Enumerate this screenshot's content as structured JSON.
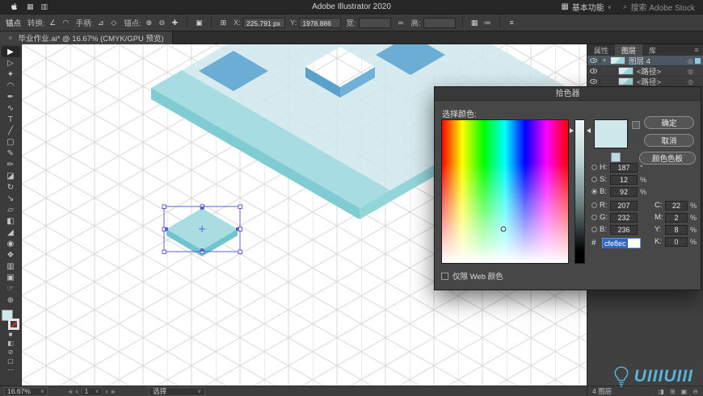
{
  "menubar": {
    "title": "Adobe Illustrator 2020",
    "left_icons": [
      {
        "name": "app-home-icon",
        "glyph": "▦"
      },
      {
        "name": "arrange-documents-icon",
        "glyph": "▥"
      }
    ],
    "workspace": {
      "icon": "▦",
      "label": "基本功能",
      "caret": "∨"
    },
    "search": {
      "icon": "⌕",
      "placeholder": "搜索 Adobe Stock"
    }
  },
  "controlbar": {
    "context_label": "锚点",
    "convert": {
      "label": "转换:",
      "icons": [
        "∠",
        "◠"
      ]
    },
    "handles": {
      "label": "手柄:",
      "icons": [
        "⊿",
        "◇"
      ]
    },
    "anchors": {
      "label": "锚点:",
      "icons": [
        "⊕",
        "⊖",
        "✚"
      ]
    },
    "isolate_icon": "▣",
    "ref_icon": "⊞",
    "x_label": "X:",
    "x_value": "225.791 px",
    "y_label": "Y:",
    "y_value": "1978.886",
    "w_label": "宽:",
    "w_value": "",
    "h_label": "高:",
    "h_value": "",
    "link_icon": "∞",
    "extra_icons": [
      "▦",
      "≔"
    ],
    "menu_icon": "≡"
  },
  "doc_tab": {
    "close": "×",
    "title": "毕业作业.ai* @ 16.67% (CMYK/GPU 预览)"
  },
  "toolbar": {
    "tools": [
      {
        "name": "selection-tool",
        "glyph": "▶",
        "active": true
      },
      {
        "name": "direct-selection-tool",
        "glyph": "▷"
      },
      {
        "name": "magic-wand-tool",
        "glyph": "✦"
      },
      {
        "name": "lasso-tool",
        "glyph": "◠"
      },
      {
        "name": "pen-tool",
        "glyph": "✒"
      },
      {
        "name": "curvature-tool",
        "glyph": "∿"
      },
      {
        "name": "type-tool",
        "glyph": "T"
      },
      {
        "name": "line-segment-tool",
        "glyph": "╱"
      },
      {
        "name": "rectangle-tool",
        "glyph": "▢"
      },
      {
        "name": "paintbrush-tool",
        "glyph": "✎"
      },
      {
        "name": "pencil-tool",
        "glyph": "✏"
      },
      {
        "name": "eraser-tool",
        "glyph": "◪"
      },
      {
        "name": "rotate-tool",
        "glyph": "↻"
      },
      {
        "name": "scale-tool",
        "glyph": "↘"
      },
      {
        "name": "shape-builder-tool",
        "glyph": "▱"
      },
      {
        "name": "gradient-tool",
        "glyph": "◧"
      },
      {
        "name": "eyedropper-tool",
        "glyph": "◢"
      },
      {
        "name": "blend-tool",
        "glyph": "◉"
      },
      {
        "name": "symbol-sprayer-tool",
        "glyph": "❖"
      },
      {
        "name": "column-graph-tool",
        "glyph": "▥"
      },
      {
        "name": "artboard-tool",
        "glyph": "▣"
      },
      {
        "name": "hand-tool",
        "glyph": "☞"
      },
      {
        "name": "zoom-tool",
        "glyph": "⊕"
      }
    ],
    "fill_color": "#cfe8ec",
    "extras": [
      {
        "name": "color-swatch-icon",
        "glyph": "■"
      },
      {
        "name": "gradient-swatch-icon",
        "glyph": "◧"
      },
      {
        "name": "none-swatch-icon",
        "glyph": "⊘"
      },
      {
        "name": "draw-mode-icon",
        "glyph": "▢"
      },
      {
        "name": "more-tools-icon",
        "glyph": "⋯"
      }
    ]
  },
  "canvas_colors": {
    "teal_light": "#cfe8ec",
    "teal_mid": "#9bd9de",
    "teal_dark": "#7fccd2",
    "blue": "#63a7d3",
    "selection": "#5f5fd6",
    "grid": "#d9d9d9"
  },
  "picker": {
    "title": "拾色器",
    "select_label": "选择颜色:",
    "buttons": {
      "ok": "确定",
      "cancel": "取消",
      "swatches": "颜色色板"
    },
    "web_only_label": "仅限 Web 颜色",
    "hsb": [
      {
        "label": "H:",
        "value": "187",
        "unit": "°",
        "selected": false
      },
      {
        "label": "S:",
        "value": "12",
        "unit": "%",
        "selected": false
      },
      {
        "label": "B:",
        "value": "92",
        "unit": "%",
        "selected": true
      }
    ],
    "rgb": [
      {
        "label": "R:",
        "value": "207"
      },
      {
        "label": "G:",
        "value": "232"
      },
      {
        "label": "B:",
        "value": "236"
      }
    ],
    "cmyk": [
      {
        "label": "C:",
        "value": "22",
        "unit": "%"
      },
      {
        "label": "M:",
        "value": "2",
        "unit": "%"
      },
      {
        "label": "Y:",
        "value": "8",
        "unit": "%"
      },
      {
        "label": "K:",
        "value": "0",
        "unit": "%"
      }
    ],
    "hex_label": "#",
    "hex_value": "cfe8ec",
    "current_color": "#cfe8ec"
  },
  "layers_panel": {
    "tabs": [
      {
        "label": "属性"
      },
      {
        "label": "图层",
        "active": true
      },
      {
        "label": "库"
      }
    ],
    "menu_icon": "≡",
    "rows": [
      {
        "name": "图层 4",
        "chevron": "▾",
        "selected": true,
        "target": "◎"
      },
      {
        "name": "<路径>",
        "chevron": "",
        "indent": true,
        "target": "◎"
      },
      {
        "name": "<路径>",
        "chevron": "",
        "indent": true,
        "target": "◎"
      }
    ],
    "footer": {
      "count": "4 图层",
      "icons": [
        {
          "name": "make-clip-mask-icon",
          "glyph": "◨"
        },
        {
          "name": "new-sublayer-icon",
          "glyph": "⊞"
        },
        {
          "name": "new-layer-icon",
          "glyph": "▣"
        },
        {
          "name": "delete-selection-icon",
          "glyph": "⊖"
        }
      ]
    }
  },
  "statusbar": {
    "zoom": "16.67%",
    "zoom_caret": "∨",
    "nav_first": "«",
    "nav_prev": "‹",
    "artboard": "1",
    "artboard_caret": "∨",
    "nav_next": "›",
    "nav_last": "»",
    "tool_label": "选择",
    "tool_caret": "∨"
  },
  "watermark": {
    "text": "UIIIUIII"
  }
}
